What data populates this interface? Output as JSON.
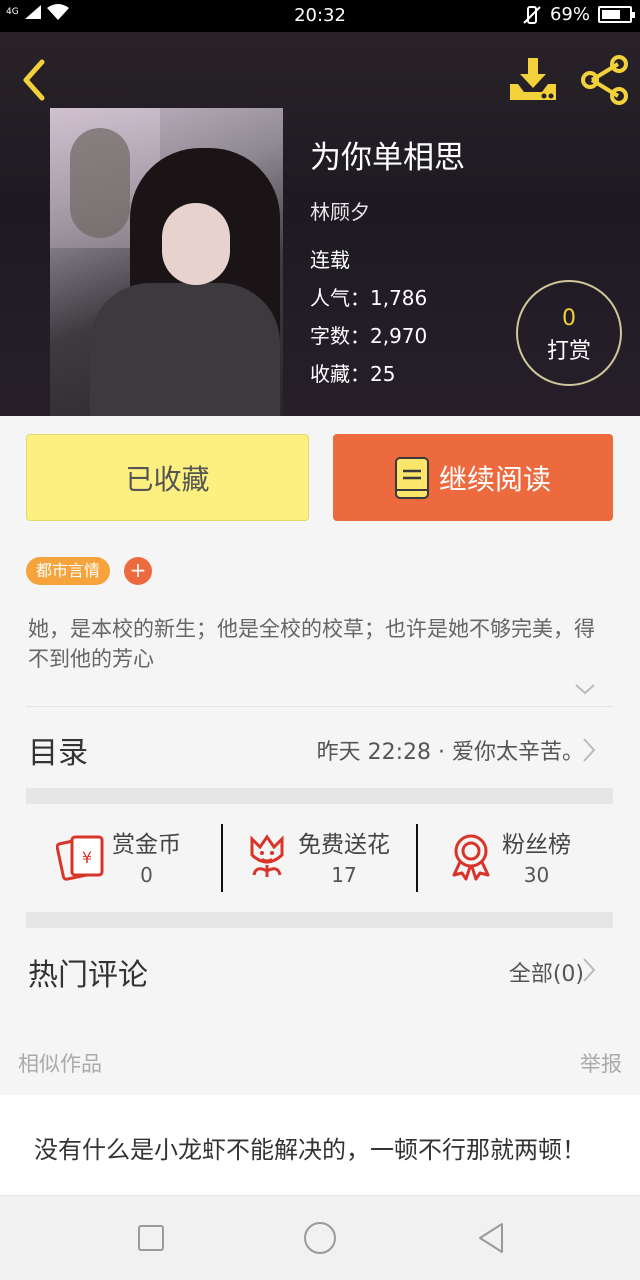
{
  "status_bar": {
    "network": "4G",
    "time": "20:32",
    "battery_percent": "69%",
    "battery_level": 0.69
  },
  "book": {
    "title": "为你单相思",
    "author": "林顾夕",
    "status": "连载",
    "popularity": "人气：1,786",
    "word_count": "字数：2,970",
    "favorites": "收藏：25",
    "reward_count": "0",
    "reward_label": "打赏"
  },
  "actions": {
    "favorite_label": "已收藏",
    "continue_label": "继续阅读"
  },
  "tags": {
    "genre": "都市言情",
    "add": "+"
  },
  "synopsis": "她，是本校的新生；他是全校的校草；也许是她不够完美，得不到他的芳心",
  "toc": {
    "label": "目录",
    "latest": "昨天 22:28 · 爱你太辛苦。"
  },
  "stats": [
    {
      "label": "赏金币",
      "value": "0",
      "icon": "red-envelope-icon"
    },
    {
      "label": "免费送花",
      "value": "17",
      "icon": "flower-icon"
    },
    {
      "label": "粉丝榜",
      "value": "30",
      "icon": "medal-icon"
    }
  ],
  "comments": {
    "label": "热门评论",
    "all": "全部(0)"
  },
  "similar": {
    "label": "相似作品",
    "report": "举报"
  },
  "recommendation": {
    "text": "没有什么是小龙虾不能解决的，一顿不行那就两顿！"
  },
  "colors": {
    "accent_orange": "#ec6a3e",
    "favorite_yellow": "#fdf081",
    "tag_orange": "#f5a33a",
    "icon_yellow": "#f3d13a",
    "stat_red": "#d8352a"
  }
}
